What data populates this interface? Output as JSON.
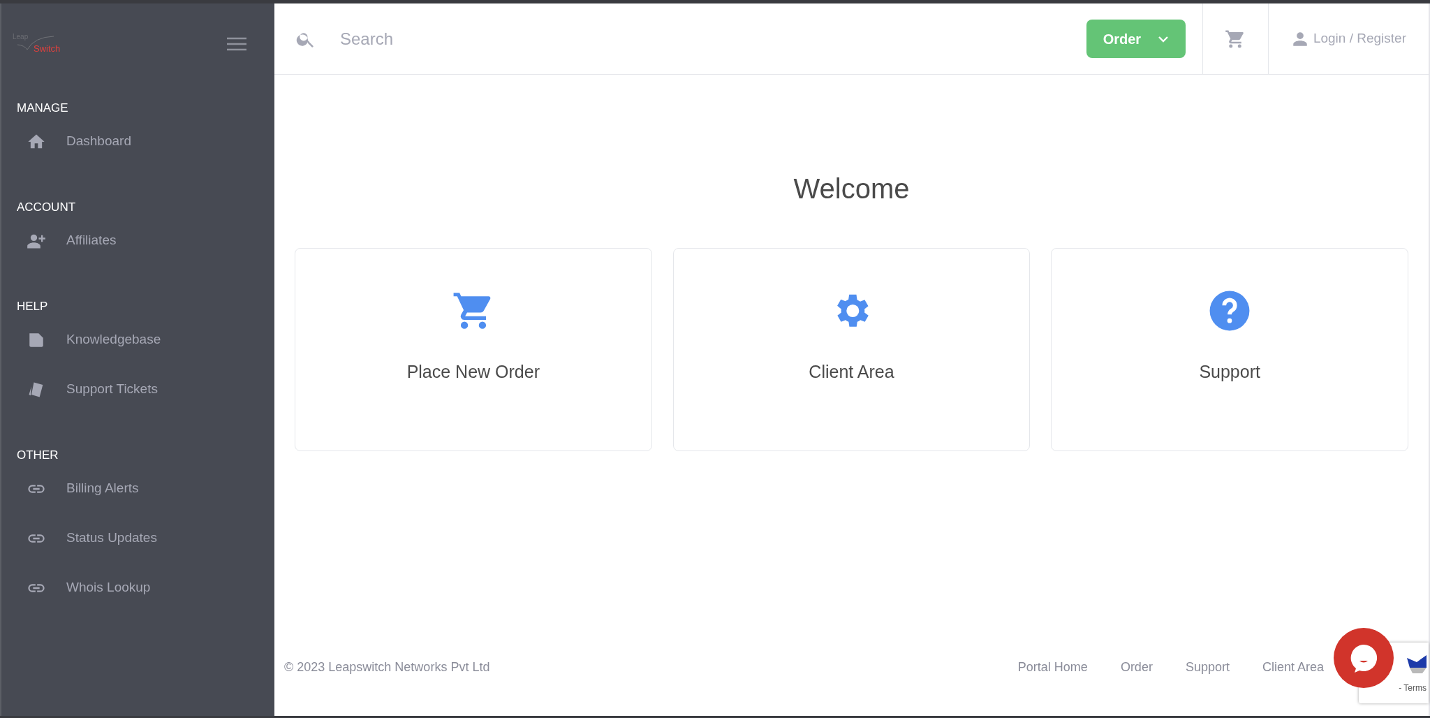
{
  "logo": {
    "part_1": "Leap",
    "part_2": "Switch"
  },
  "sidebar": {
    "sections": [
      {
        "title": "MANAGE",
        "items": [
          {
            "label": "Dashboard"
          }
        ]
      },
      {
        "title": "ACCOUNT",
        "items": [
          {
            "label": "Affiliates"
          }
        ]
      },
      {
        "title": "HELP",
        "items": [
          {
            "label": "Knowledgebase"
          },
          {
            "label": "Support Tickets"
          }
        ]
      },
      {
        "title": "OTHER",
        "items": [
          {
            "label": "Billing Alerts"
          },
          {
            "label": "Status Updates"
          },
          {
            "label": "Whois Lookup"
          }
        ]
      }
    ]
  },
  "topbar": {
    "search": {
      "placeholder": "Search"
    },
    "order_button": "Order",
    "login": "Login / Register"
  },
  "main": {
    "heading": "Welcome",
    "cards": [
      {
        "label": "Place New Order"
      },
      {
        "label": "Client Area"
      },
      {
        "label": "Support"
      }
    ]
  },
  "footer": {
    "copyright": "© 2023 Leapswitch Networks Pvt Ltd",
    "links": [
      "Portal Home",
      "Order",
      "Support",
      "Client Area"
    ]
  },
  "recaptcha": {
    "text": "- Terms"
  }
}
